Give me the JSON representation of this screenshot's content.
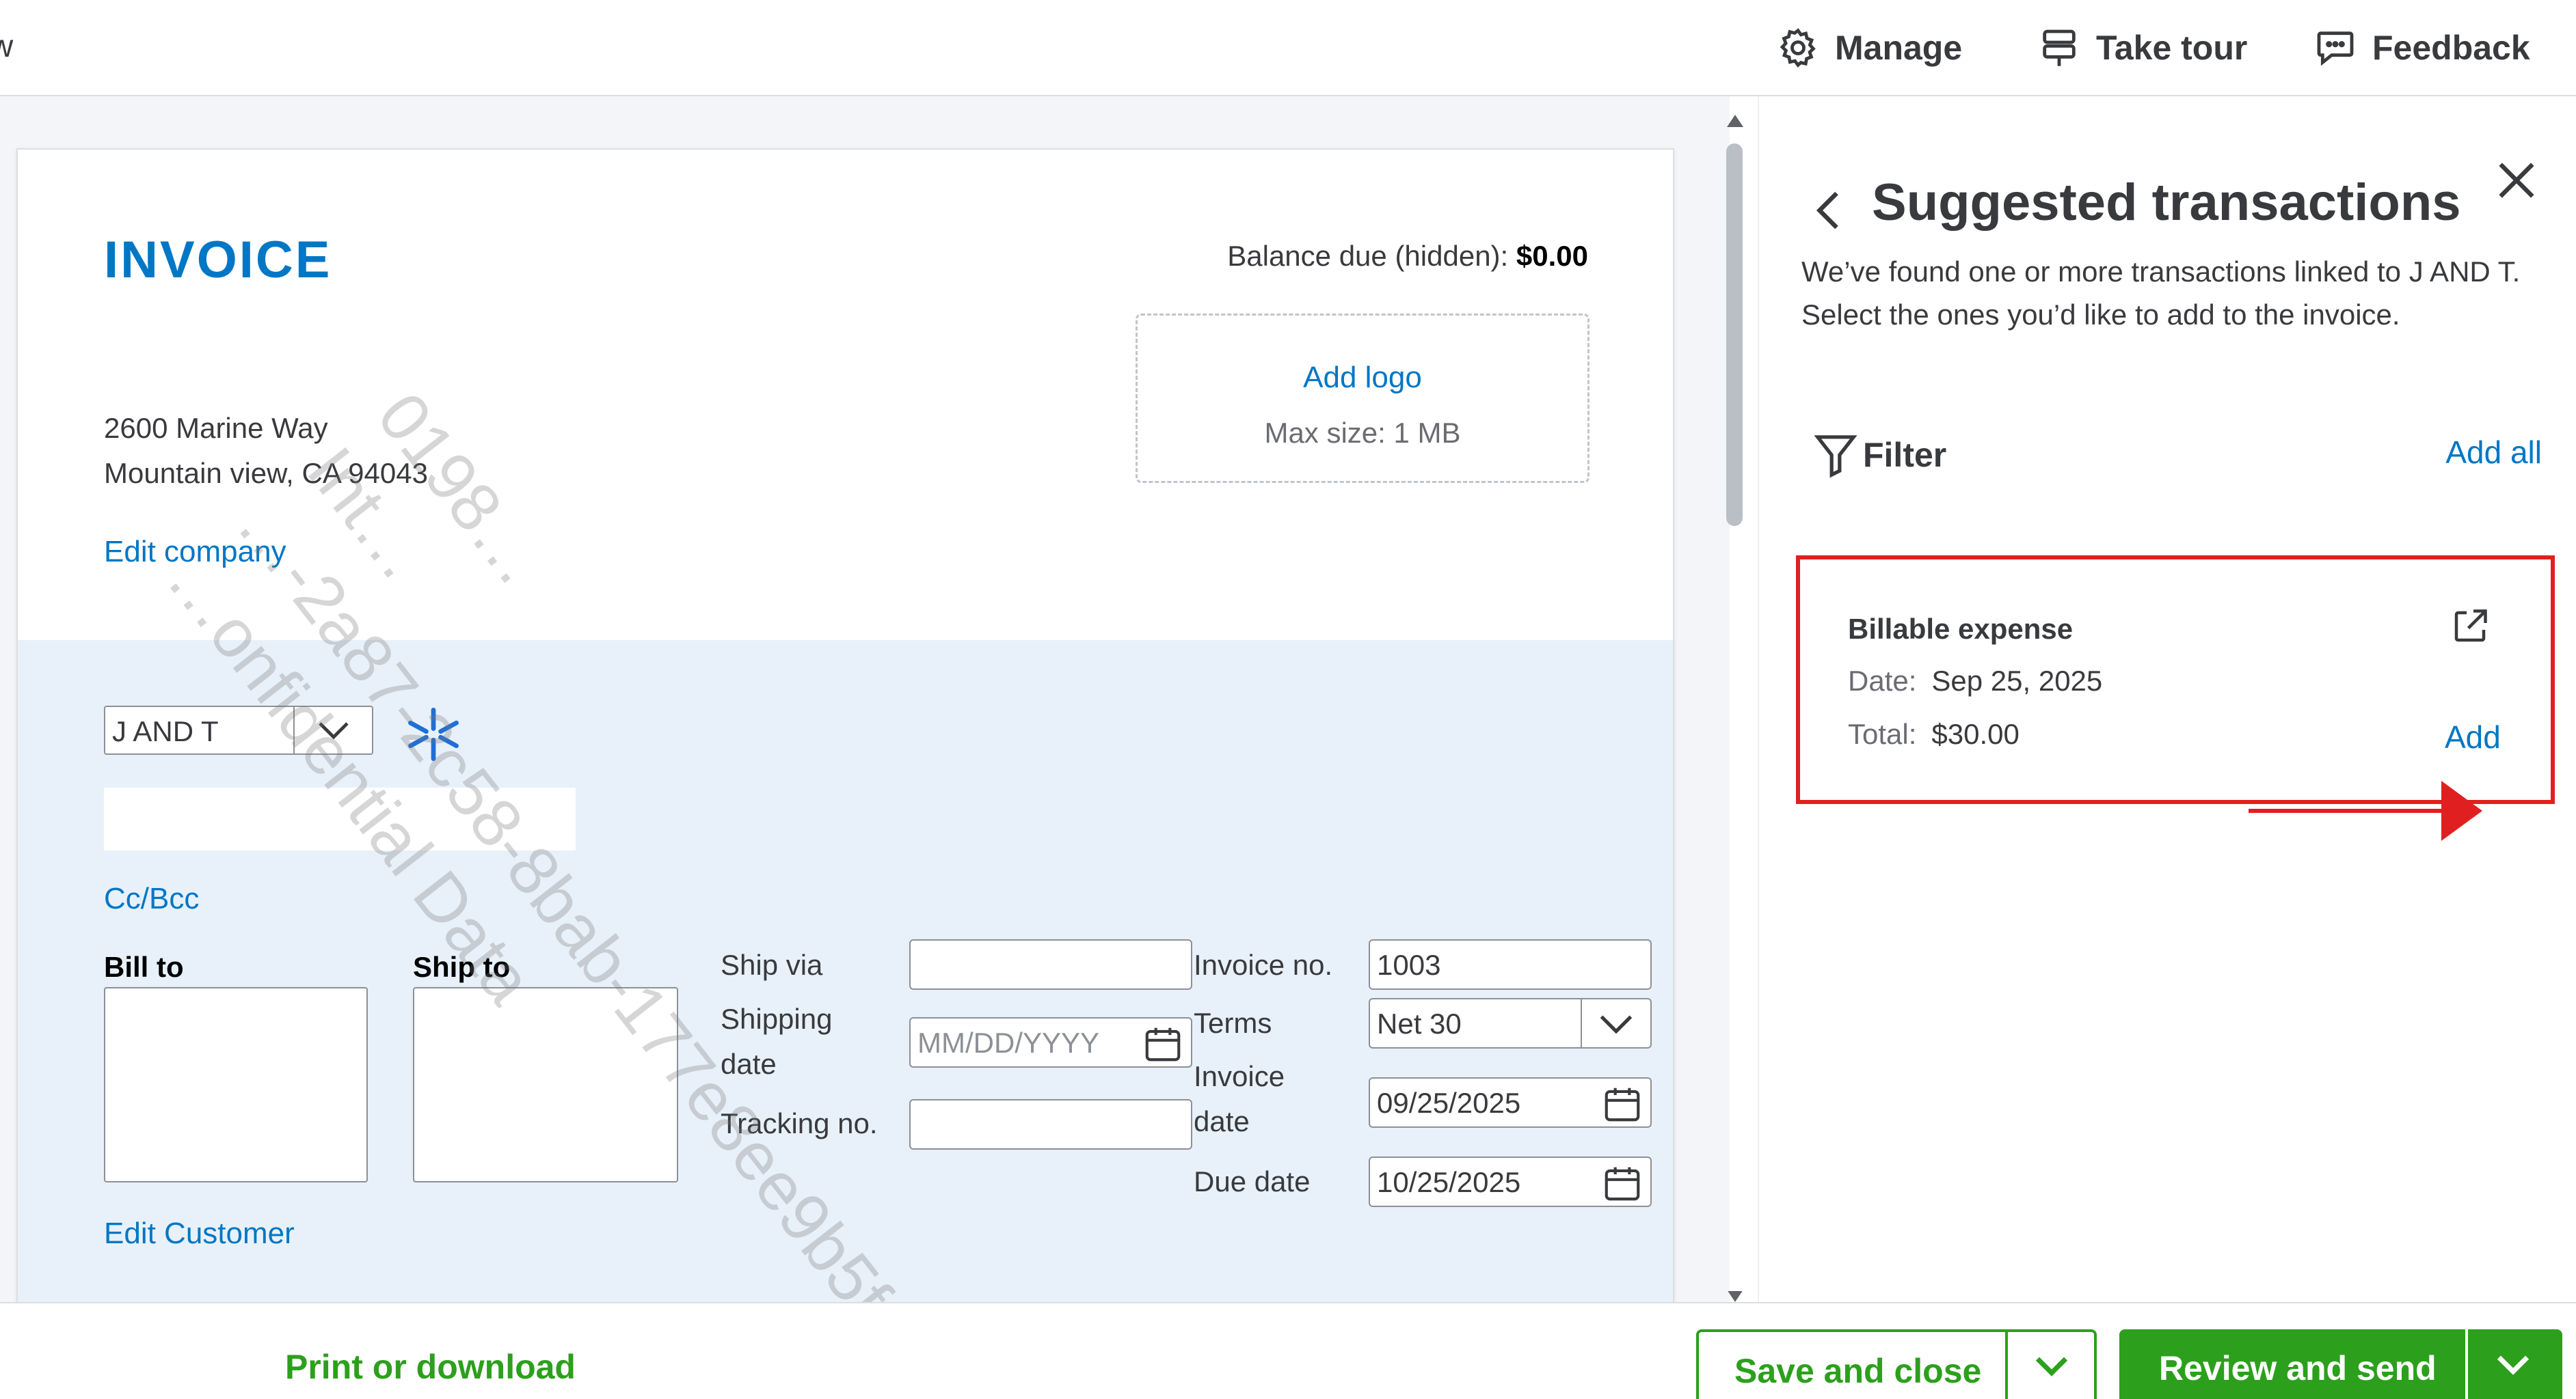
{
  "topbar": {
    "cut_text": "w",
    "manage_label": "Manage",
    "tour_label": "Take tour",
    "feedback_label": "Feedback"
  },
  "invoice": {
    "title": "INVOICE",
    "balance_label": "Balance due (hidden):",
    "balance_value": "$0.00",
    "add_logo": "Add logo",
    "logo_max": "Max size: 1 MB",
    "address_line1": "2600 Marine Way",
    "address_line2": "Mountain view, CA 94043",
    "edit_company": "Edit company",
    "customer": "J AND T",
    "cc_bcc": "Cc/Bcc",
    "bill_to": "Bill to",
    "ship_to": "Ship to",
    "ship_via_label": "Ship via",
    "shipping_date_label_1": "Shipping",
    "shipping_date_label_2": "date",
    "shipping_date_placeholder": "MM/DD/YYYY",
    "tracking_label": "Tracking no.",
    "invoice_no_label": "Invoice no.",
    "invoice_no_value": "1003",
    "terms_label": "Terms",
    "terms_value": "Net 30",
    "invoice_date_label_1": "Invoice",
    "invoice_date_label_2": "date",
    "invoice_date_value": "09/25/2025",
    "due_date_label": "Due date",
    "due_date_value": "10/25/2025",
    "edit_customer": "Edit Customer"
  },
  "watermark": {
    "line1": "0198…",
    "line2": "Int…",
    "line3": "…-2a87-2c58-8bab-177e8ee9b5f",
    "line4": "…onfidential Data"
  },
  "panel": {
    "title": "Suggested transactions",
    "description": "We’ve found one or more transactions linked to J AND T. Select the ones you’d like to add to the invoice.",
    "filter_label": "Filter",
    "add_all": "Add all",
    "transaction": {
      "type": "Billable expense",
      "date_label": "Date:",
      "date_value": "Sep 25, 2025",
      "total_label": "Total:",
      "total_value": "$30.00",
      "add_label": "Add"
    }
  },
  "bottombar": {
    "print_label": "Print or download",
    "save_close_label": "Save and close",
    "review_send_label": "Review and send"
  },
  "colors": {
    "accent_blue": "#0077c5",
    "brand_green": "#2ca01c",
    "highlight_red": "#e02020"
  }
}
